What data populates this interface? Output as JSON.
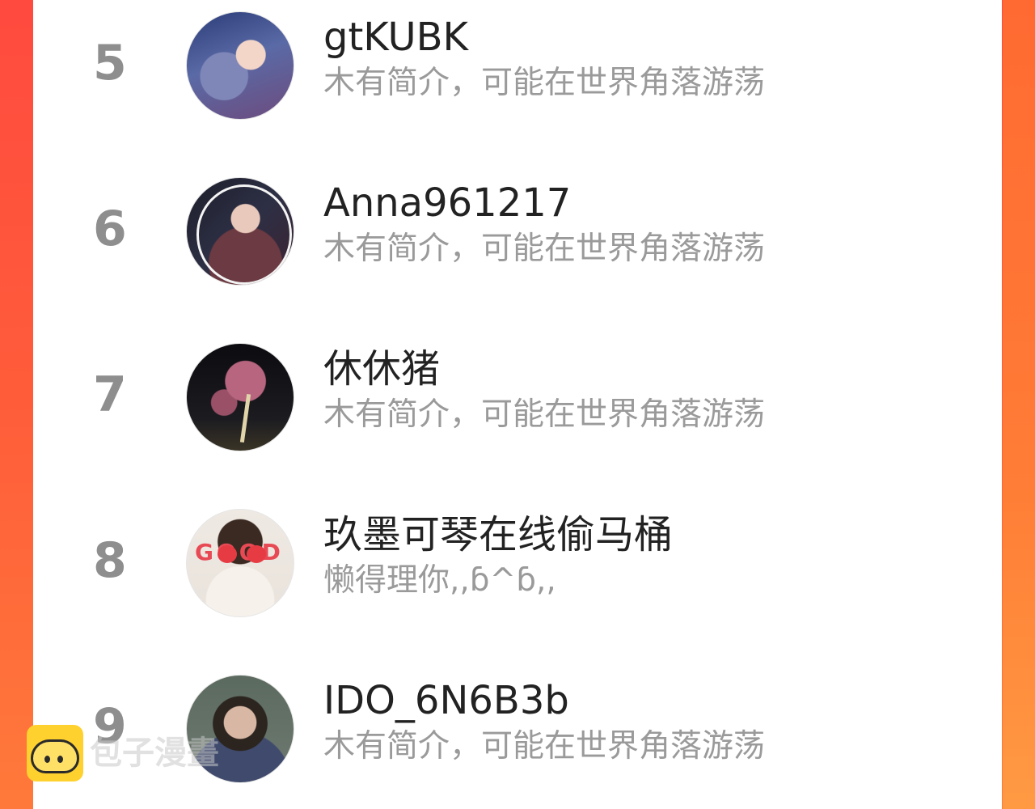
{
  "rows": [
    {
      "rank": "5",
      "name": "gtKUBK",
      "bio": "木有简介，可能在世界角落游荡"
    },
    {
      "rank": "6",
      "name": "Anna961217",
      "bio": "木有简介，可能在世界角落游荡"
    },
    {
      "rank": "7",
      "name": "休休猪",
      "bio": "木有简介，可能在世界角落游荡"
    },
    {
      "rank": "8",
      "name": "玖墨可琴在线偷马桶",
      "bio": "懒得理你,,ɓ^ɓ,,",
      "avatar_text": "GOOD"
    },
    {
      "rank": "9",
      "name": "IDO_6N6B3b",
      "bio": "木有简介，可能在世界角落游荡"
    }
  ],
  "watermark": {
    "text": "包子漫畫"
  },
  "colors": {
    "background": "#ff5a3c",
    "card": "#ffffff",
    "rank": "#8e8e8e",
    "bio": "#9a9a9a"
  }
}
